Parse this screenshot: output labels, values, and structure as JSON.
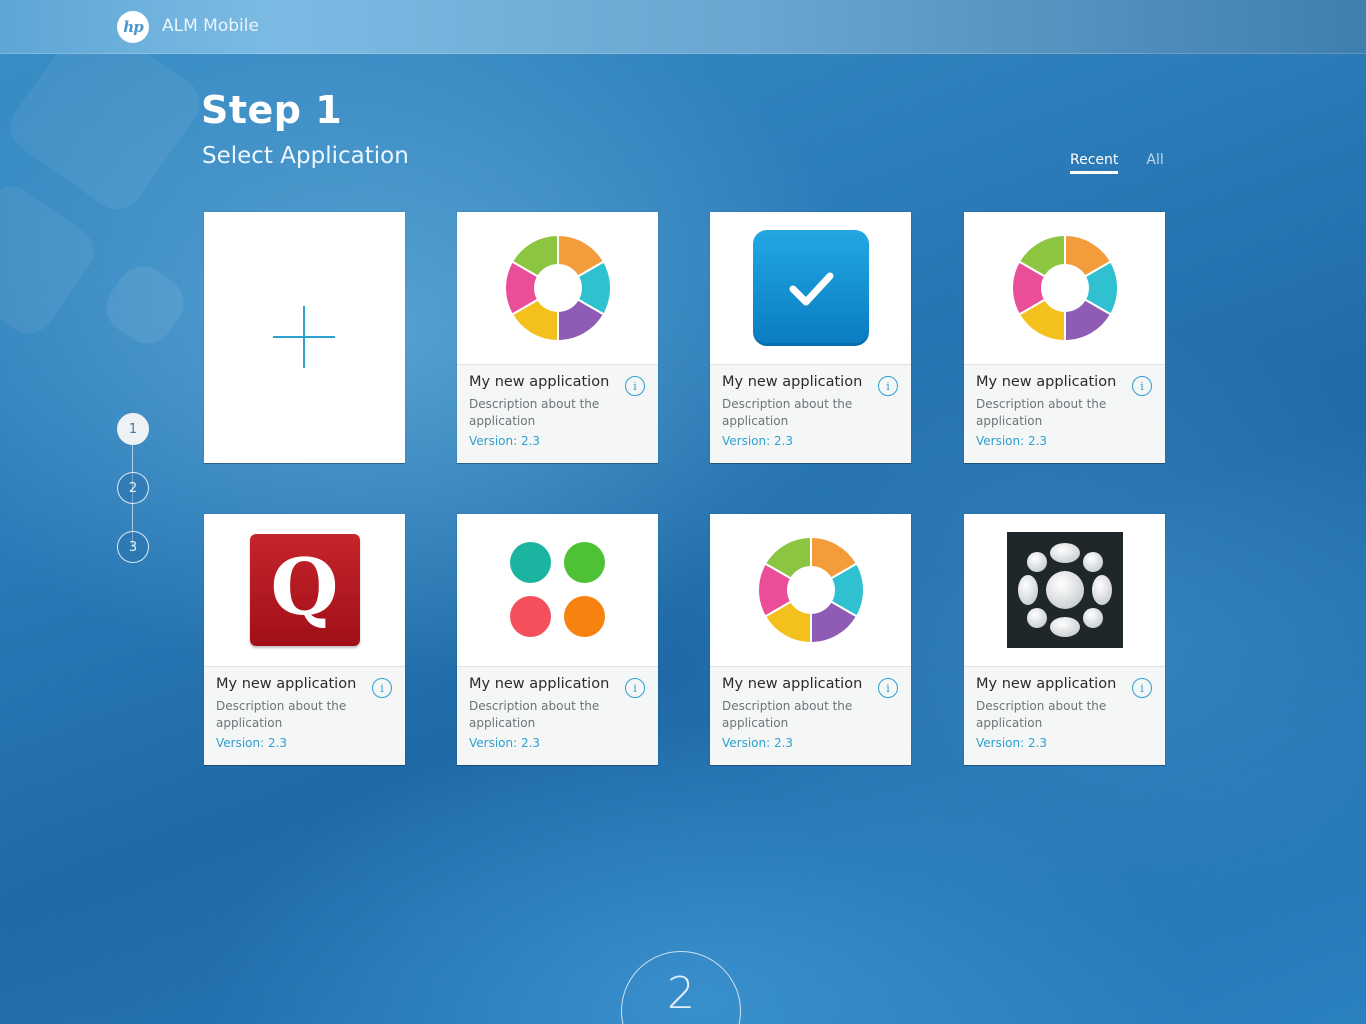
{
  "header": {
    "app_title": "ALM Mobile",
    "logo_text": "hp"
  },
  "page": {
    "step_title": "Step 1",
    "step_subtitle": "Select Application"
  },
  "filters": {
    "recent": "Recent",
    "all": "All",
    "selected": "Recent"
  },
  "stepper": [
    "1",
    "2",
    "3"
  ],
  "stepper_active": "1",
  "cards": [
    {
      "icon": "add-icon"
    },
    {
      "icon": "color-ring-icon",
      "name": "My new application",
      "description": "Description about the application",
      "version": "Version: 2.3"
    },
    {
      "icon": "checkmark-tile-icon",
      "name": "My new application",
      "description": "Description about the application",
      "version": "Version: 2.3"
    },
    {
      "icon": "color-ring-icon",
      "name": "My new application",
      "description": "Description about the application",
      "version": "Version: 2.3"
    },
    {
      "icon": "q-letter-tile-icon",
      "name": "My new application",
      "description": "Description about the application",
      "version": "Version: 2.3",
      "letter": "Q"
    },
    {
      "icon": "four-dots-icon",
      "name": "My new application",
      "description": "Description about the application",
      "version": "Version: 2.3"
    },
    {
      "icon": "color-ring-icon",
      "name": "My new application",
      "description": "Description about the application",
      "version": "Version: 2.3"
    },
    {
      "icon": "dot-cluster-tile-icon",
      "name": "My new application",
      "description": "Description about the application",
      "version": "Version: 2.3"
    }
  ],
  "info_glyph": "i",
  "next_step": "2",
  "colors": {
    "accent": "#2ea1d1",
    "ring": [
      "#f39c3b",
      "#2fc1cf",
      "#8e5bb5",
      "#f4c11c",
      "#ea4e98",
      "#8cc53f"
    ],
    "dots": [
      "#1ab4a0",
      "#4ec234",
      "#f4505c",
      "#f7820f"
    ],
    "q_tile": "#b31a22",
    "check_tile": "#1599d8"
  }
}
